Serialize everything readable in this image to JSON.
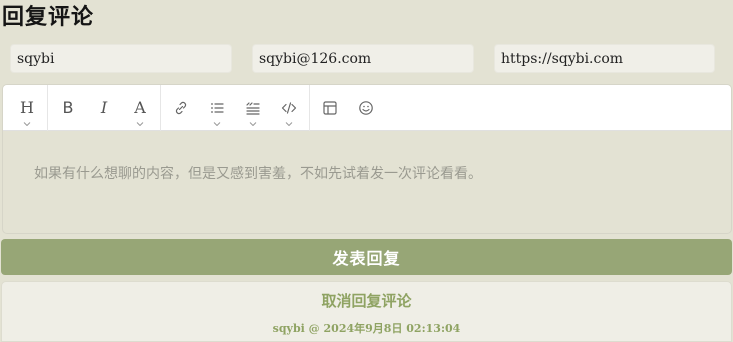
{
  "header": {
    "title": "回复评论"
  },
  "form": {
    "name_value": "sqybi",
    "email_value": "sqybi@126.com",
    "url_value": "https://sqybi.com",
    "comment_placeholder": "如果有什么想聊的内容，但是又感到害羞，不如先试着发一次评论看看。"
  },
  "toolbar": {
    "heading_glyph": "H",
    "bold_glyph": "B",
    "italic_glyph": "I",
    "font_glyph": "A",
    "icons": [
      "heading-icon",
      "bold-icon",
      "italic-icon",
      "font-color-icon",
      "link-icon",
      "list-icon",
      "quote-icon",
      "code-icon",
      "table-icon",
      "emoji-icon"
    ]
  },
  "actions": {
    "submit_label": "发表回复",
    "cancel_label": "取消回复评论"
  },
  "reply_target": {
    "author": "sqybi",
    "separator": "@",
    "timestamp": "2024年9月8日 02:13:04"
  },
  "colors": {
    "accent": "#97a676",
    "accent_text": "#8fa363",
    "background": "#e3e2d3"
  }
}
